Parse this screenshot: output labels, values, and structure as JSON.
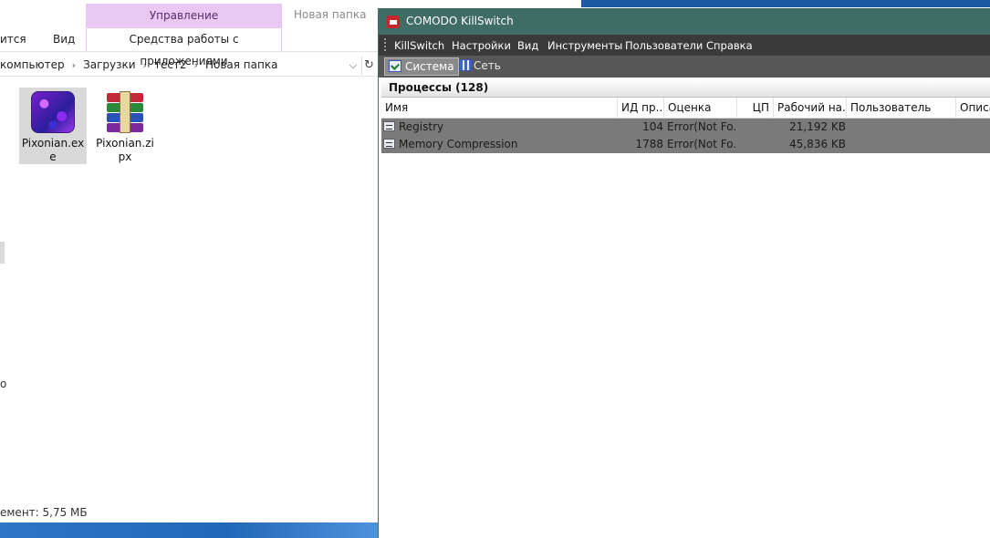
{
  "explorer": {
    "ribbon": {
      "tab_share": "ится",
      "tab_view": "Вид",
      "manage_group": "Управление",
      "app_tools_tab": "Средства работы с приложениями",
      "window_title": "Новая папка"
    },
    "breadcrumb": [
      "компьютер",
      "Загрузки",
      "тест2",
      "Новая папка"
    ],
    "nav_pane_fragment": "о",
    "files": [
      {
        "name_line1": "Pixonian.ex",
        "name_line2": "e",
        "icon": "exe-app-icon",
        "selected": true
      },
      {
        "name_line1": "Pixonian.zi",
        "name_line2": "px",
        "icon": "winrar-archive-icon",
        "selected": false
      }
    ],
    "status": "емент: 5,75 МБ"
  },
  "killswitch": {
    "title": "COMODO KillSwitch",
    "menu": [
      "KillSwitch",
      "Настройки",
      "Вид",
      "Инструменты",
      "Пользователи",
      "Справка"
    ],
    "toolbar": {
      "system": "Система",
      "network": "Сеть"
    },
    "processes_header": "Процессы (128)",
    "columns": [
      "Имя",
      "ИД пр...",
      "Оценка",
      "ЦП",
      "Рабочий на...",
      "Пользователь",
      "Описа"
    ],
    "rows": [
      {
        "name": "Registry",
        "pid": "104",
        "rating": "Error(Not Fo...",
        "cpu": "",
        "working_set": "21,192 KB",
        "user": "",
        "description": ""
      },
      {
        "name": "Memory Compression",
        "pid": "1788",
        "rating": "Error(Not Fo...",
        "cpu": "",
        "working_set": "45,836 KB",
        "user": "",
        "description": ""
      }
    ],
    "colors": {
      "title_bar": "#3f6d66",
      "menu_bar": "#3a3a3a",
      "toolbar": "#575757",
      "row_bg": "#7a7a7a"
    }
  }
}
